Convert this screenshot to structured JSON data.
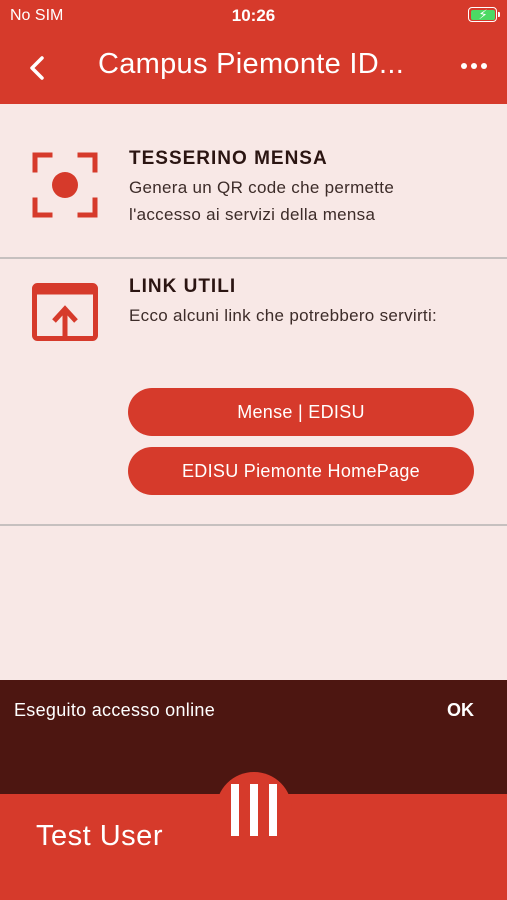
{
  "status_bar": {
    "carrier": "No SIM",
    "time": "10:26"
  },
  "nav": {
    "back_icon": "chevron-left-icon",
    "title": "Campus Piemonte ID...",
    "more_icon": "more-horizontal-icon"
  },
  "sections": [
    {
      "icon": "qr-scan-icon",
      "title": "TESSERINO MENSA",
      "description": "Genera un QR code che permette l'accesso ai servizi della mensa"
    },
    {
      "icon": "open-external-icon",
      "title": "LINK UTILI",
      "description": "Ecco alcuni link che potrebbero servirti:",
      "buttons": [
        {
          "label": "Mense | EDISU"
        },
        {
          "label": "EDISU Piemonte HomePage"
        }
      ]
    }
  ],
  "snackbar": {
    "message": "Eseguito accesso online",
    "action": "OK"
  },
  "bottom_bar": {
    "user_name": "Test User",
    "menu_icon": "bars-vertical-icon"
  },
  "colors": {
    "primary": "#d63a2b",
    "background": "#f8e8e6",
    "snackbar": "#4d1611",
    "battery": "#4cd964"
  }
}
